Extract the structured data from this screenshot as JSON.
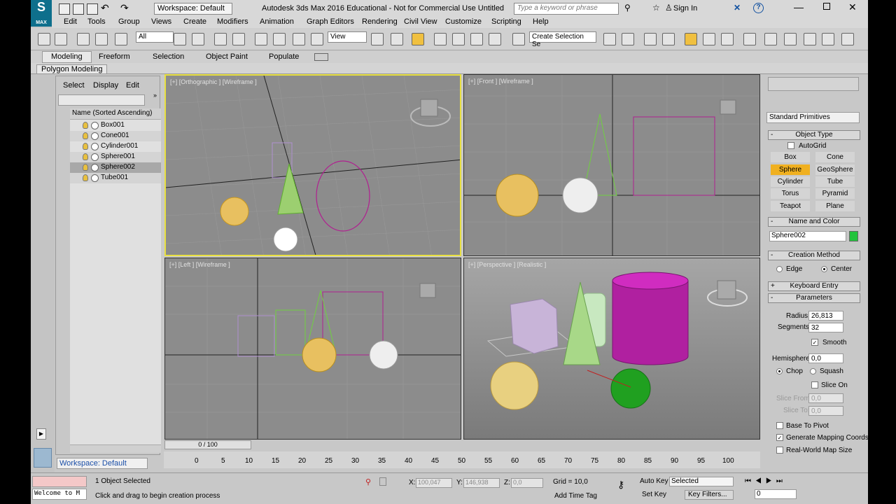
{
  "titlebar": {
    "workspace": "Workspace: Default",
    "title": "Autodesk 3ds Max 2016 Educational - Not for Commercial Use   Untitled",
    "search_placeholder": "Type a keyword or phrase",
    "sign_in": "Sign In",
    "logo": "MAX"
  },
  "menu": [
    "Edit",
    "Tools",
    "Group",
    "Views",
    "Create",
    "Modifiers",
    "Animation",
    "Graph Editors",
    "Rendering",
    "Civil View",
    "Customize",
    "Scripting",
    "Help"
  ],
  "toolbar": {
    "selection_filter": "All",
    "ref_coord": "View",
    "selection_set": "Create Selection Se"
  },
  "ribbon": {
    "tabs": [
      "Modeling",
      "Freeform",
      "Selection",
      "Object Paint",
      "Populate"
    ],
    "sub": "Polygon Modeling"
  },
  "scene_explorer": {
    "menu": [
      "Select",
      "Display",
      "Edit"
    ],
    "header": "Name (Sorted Ascending)",
    "items": [
      "Box001",
      "Cone001",
      "Cylinder001",
      "Sphere001",
      "Sphere002",
      "Tube001"
    ],
    "selected_index": 4,
    "workspace": "Workspace: Default"
  },
  "viewports": {
    "top_left": "[+] [Orthographic ] [Wireframe ]",
    "top_right": "[+] [Front ] [Wireframe ]",
    "bottom_left": "[+] [Left ] [Wireframe ]",
    "bottom_right": "[+] [Perspective ] [Realistic ]"
  },
  "command_panel": {
    "category": "Standard Primitives",
    "object_type": "Object Type",
    "autogrid": "AutoGrid",
    "buttons": [
      "Box",
      "Cone",
      "Sphere",
      "GeoSphere",
      "Cylinder",
      "Tube",
      "Torus",
      "Pyramid",
      "Teapot",
      "Plane"
    ],
    "active_button": "Sphere",
    "name_color": "Name and Color",
    "object_name": "Sphere002",
    "object_color": "#22c33c",
    "creation_method": "Creation Method",
    "edge": "Edge",
    "center": "Center",
    "keyboard_entry": "Keyboard Entry",
    "parameters": "Parameters",
    "radius_label": "Radius:",
    "radius": "26,813",
    "segments_label": "Segments:",
    "segments": "32",
    "smooth": "Smooth",
    "hemisphere_label": "Hemisphere:",
    "hemisphere": "0,0",
    "chop": "Chop",
    "squash": "Squash",
    "slice_on": "Slice On",
    "slice_from_label": "Slice From:",
    "slice_from": "0,0",
    "slice_to_label": "Slice To:",
    "slice_to": "0,0",
    "base_to_pivot": "Base To Pivot",
    "gen_mapping": "Generate Mapping Coords",
    "real_world": "Real-World Map Size"
  },
  "timeline": {
    "frame": "0 / 100",
    "ticks": [
      "0",
      "5",
      "10",
      "15",
      "20",
      "25",
      "30",
      "35",
      "40",
      "45",
      "50",
      "55",
      "60",
      "65",
      "70",
      "75",
      "80",
      "85",
      "90",
      "95",
      "100"
    ]
  },
  "status": {
    "maxscript": "Welcome to M",
    "selected": "1 Object Selected",
    "prompt": "Click and drag to begin creation process",
    "x_label": "X:",
    "x": "100,047",
    "y_label": "Y:",
    "y": "146,938",
    "z_label": "Z:",
    "z": "0,0",
    "grid": "Grid = 10,0",
    "add_time_tag": "Add Time Tag",
    "auto_key": "Auto Key",
    "set_key": "Set Key",
    "key_mode": "Selected",
    "key_filters": "Key Filters...",
    "current_frame": "0"
  }
}
